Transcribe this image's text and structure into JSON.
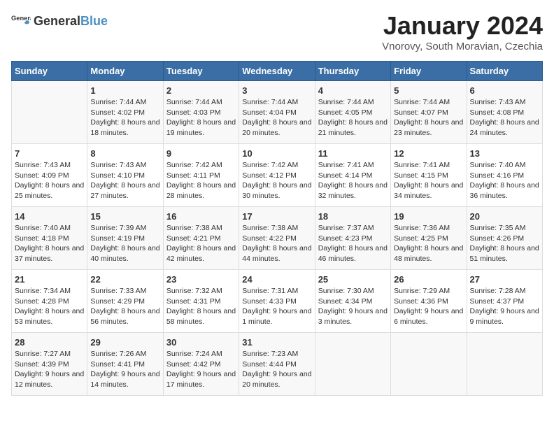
{
  "header": {
    "logo_general": "General",
    "logo_blue": "Blue",
    "month_title": "January 2024",
    "location": "Vnorovy, South Moravian, Czechia"
  },
  "weekdays": [
    "Sunday",
    "Monday",
    "Tuesday",
    "Wednesday",
    "Thursday",
    "Friday",
    "Saturday"
  ],
  "weeks": [
    [
      {
        "day": "",
        "sunrise": "",
        "sunset": "",
        "daylight": ""
      },
      {
        "day": "1",
        "sunrise": "Sunrise: 7:44 AM",
        "sunset": "Sunset: 4:02 PM",
        "daylight": "Daylight: 8 hours and 18 minutes."
      },
      {
        "day": "2",
        "sunrise": "Sunrise: 7:44 AM",
        "sunset": "Sunset: 4:03 PM",
        "daylight": "Daylight: 8 hours and 19 minutes."
      },
      {
        "day": "3",
        "sunrise": "Sunrise: 7:44 AM",
        "sunset": "Sunset: 4:04 PM",
        "daylight": "Daylight: 8 hours and 20 minutes."
      },
      {
        "day": "4",
        "sunrise": "Sunrise: 7:44 AM",
        "sunset": "Sunset: 4:05 PM",
        "daylight": "Daylight: 8 hours and 21 minutes."
      },
      {
        "day": "5",
        "sunrise": "Sunrise: 7:44 AM",
        "sunset": "Sunset: 4:07 PM",
        "daylight": "Daylight: 8 hours and 23 minutes."
      },
      {
        "day": "6",
        "sunrise": "Sunrise: 7:43 AM",
        "sunset": "Sunset: 4:08 PM",
        "daylight": "Daylight: 8 hours and 24 minutes."
      }
    ],
    [
      {
        "day": "7",
        "sunrise": "Sunrise: 7:43 AM",
        "sunset": "Sunset: 4:09 PM",
        "daylight": "Daylight: 8 hours and 25 minutes."
      },
      {
        "day": "8",
        "sunrise": "Sunrise: 7:43 AM",
        "sunset": "Sunset: 4:10 PM",
        "daylight": "Daylight: 8 hours and 27 minutes."
      },
      {
        "day": "9",
        "sunrise": "Sunrise: 7:42 AM",
        "sunset": "Sunset: 4:11 PM",
        "daylight": "Daylight: 8 hours and 28 minutes."
      },
      {
        "day": "10",
        "sunrise": "Sunrise: 7:42 AM",
        "sunset": "Sunset: 4:12 PM",
        "daylight": "Daylight: 8 hours and 30 minutes."
      },
      {
        "day": "11",
        "sunrise": "Sunrise: 7:41 AM",
        "sunset": "Sunset: 4:14 PM",
        "daylight": "Daylight: 8 hours and 32 minutes."
      },
      {
        "day": "12",
        "sunrise": "Sunrise: 7:41 AM",
        "sunset": "Sunset: 4:15 PM",
        "daylight": "Daylight: 8 hours and 34 minutes."
      },
      {
        "day": "13",
        "sunrise": "Sunrise: 7:40 AM",
        "sunset": "Sunset: 4:16 PM",
        "daylight": "Daylight: 8 hours and 36 minutes."
      }
    ],
    [
      {
        "day": "14",
        "sunrise": "Sunrise: 7:40 AM",
        "sunset": "Sunset: 4:18 PM",
        "daylight": "Daylight: 8 hours and 37 minutes."
      },
      {
        "day": "15",
        "sunrise": "Sunrise: 7:39 AM",
        "sunset": "Sunset: 4:19 PM",
        "daylight": "Daylight: 8 hours and 40 minutes."
      },
      {
        "day": "16",
        "sunrise": "Sunrise: 7:38 AM",
        "sunset": "Sunset: 4:21 PM",
        "daylight": "Daylight: 8 hours and 42 minutes."
      },
      {
        "day": "17",
        "sunrise": "Sunrise: 7:38 AM",
        "sunset": "Sunset: 4:22 PM",
        "daylight": "Daylight: 8 hours and 44 minutes."
      },
      {
        "day": "18",
        "sunrise": "Sunrise: 7:37 AM",
        "sunset": "Sunset: 4:23 PM",
        "daylight": "Daylight: 8 hours and 46 minutes."
      },
      {
        "day": "19",
        "sunrise": "Sunrise: 7:36 AM",
        "sunset": "Sunset: 4:25 PM",
        "daylight": "Daylight: 8 hours and 48 minutes."
      },
      {
        "day": "20",
        "sunrise": "Sunrise: 7:35 AM",
        "sunset": "Sunset: 4:26 PM",
        "daylight": "Daylight: 8 hours and 51 minutes."
      }
    ],
    [
      {
        "day": "21",
        "sunrise": "Sunrise: 7:34 AM",
        "sunset": "Sunset: 4:28 PM",
        "daylight": "Daylight: 8 hours and 53 minutes."
      },
      {
        "day": "22",
        "sunrise": "Sunrise: 7:33 AM",
        "sunset": "Sunset: 4:29 PM",
        "daylight": "Daylight: 8 hours and 56 minutes."
      },
      {
        "day": "23",
        "sunrise": "Sunrise: 7:32 AM",
        "sunset": "Sunset: 4:31 PM",
        "daylight": "Daylight: 8 hours and 58 minutes."
      },
      {
        "day": "24",
        "sunrise": "Sunrise: 7:31 AM",
        "sunset": "Sunset: 4:33 PM",
        "daylight": "Daylight: 9 hours and 1 minute."
      },
      {
        "day": "25",
        "sunrise": "Sunrise: 7:30 AM",
        "sunset": "Sunset: 4:34 PM",
        "daylight": "Daylight: 9 hours and 3 minutes."
      },
      {
        "day": "26",
        "sunrise": "Sunrise: 7:29 AM",
        "sunset": "Sunset: 4:36 PM",
        "daylight": "Daylight: 9 hours and 6 minutes."
      },
      {
        "day": "27",
        "sunrise": "Sunrise: 7:28 AM",
        "sunset": "Sunset: 4:37 PM",
        "daylight": "Daylight: 9 hours and 9 minutes."
      }
    ],
    [
      {
        "day": "28",
        "sunrise": "Sunrise: 7:27 AM",
        "sunset": "Sunset: 4:39 PM",
        "daylight": "Daylight: 9 hours and 12 minutes."
      },
      {
        "day": "29",
        "sunrise": "Sunrise: 7:26 AM",
        "sunset": "Sunset: 4:41 PM",
        "daylight": "Daylight: 9 hours and 14 minutes."
      },
      {
        "day": "30",
        "sunrise": "Sunrise: 7:24 AM",
        "sunset": "Sunset: 4:42 PM",
        "daylight": "Daylight: 9 hours and 17 minutes."
      },
      {
        "day": "31",
        "sunrise": "Sunrise: 7:23 AM",
        "sunset": "Sunset: 4:44 PM",
        "daylight": "Daylight: 9 hours and 20 minutes."
      },
      {
        "day": "",
        "sunrise": "",
        "sunset": "",
        "daylight": ""
      },
      {
        "day": "",
        "sunrise": "",
        "sunset": "",
        "daylight": ""
      },
      {
        "day": "",
        "sunrise": "",
        "sunset": "",
        "daylight": ""
      }
    ]
  ]
}
